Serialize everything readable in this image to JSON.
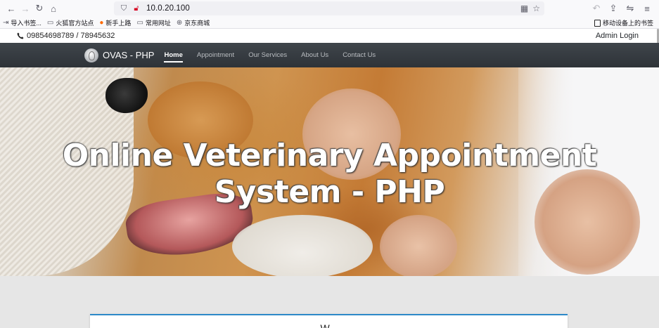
{
  "browser": {
    "url": "10.0.20.100",
    "bookmarks": [
      "导入书签...",
      "火狐官方站点",
      "新手上路",
      "常用网址",
      "京东商城"
    ],
    "mobile_bookmarks": "移动设备上的书签"
  },
  "topbar": {
    "phone": "09854698789 / 78945632",
    "admin_login": "Admin Login"
  },
  "navbar": {
    "brand": "OVAS - PHP",
    "links": [
      "Home",
      "Appointment",
      "Our Services",
      "About Us",
      "Contact Us"
    ],
    "active": "Home"
  },
  "hero": {
    "title": "Online Veterinary Appointment System - PHP"
  },
  "content": {
    "card_title": "W..."
  },
  "colors": {
    "navbar": "#343a40",
    "card_accent": "#2d89c8",
    "page_bg": "#e6e6e6"
  }
}
